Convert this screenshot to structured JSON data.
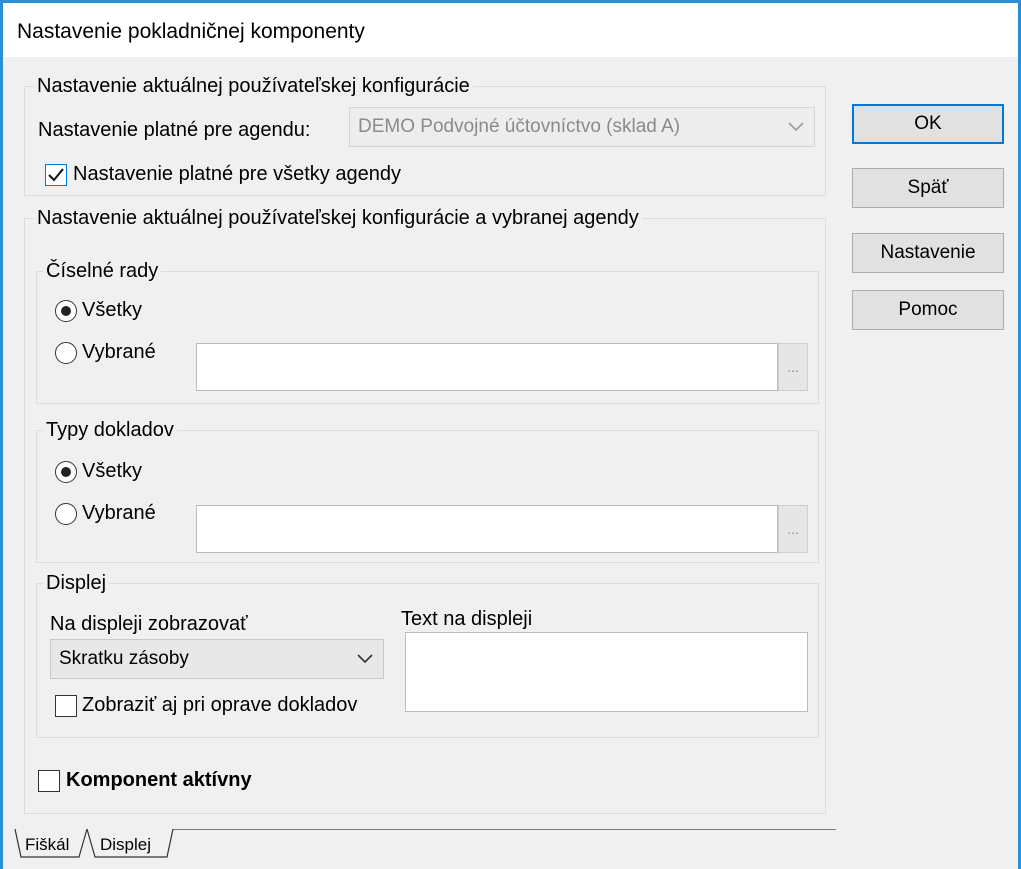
{
  "window": {
    "title": "Nastavenie pokladničnej komponenty"
  },
  "buttons": {
    "ok": "OK",
    "back": "Späť",
    "settings": "Nastavenie",
    "help": "Pomoc"
  },
  "user_config": {
    "legend": "Nastavenie aktuálnej používateľskej konfigurácie",
    "agenda_label": "Nastavenie platné pre agendu:",
    "agenda_value": "DEMO Podvojné účtovníctvo (sklad A)",
    "all_agendas_label": "Nastavenie platné pre všetky agendy",
    "all_agendas_checked": true
  },
  "user_agenda_config": {
    "legend": "Nastavenie aktuálnej používateľskej konfigurácie a vybranej agendy",
    "number_series": {
      "legend": "Číselné rady",
      "all_label": "Všetky",
      "selected_label": "Vybrané",
      "ellipsis": "..."
    },
    "document_types": {
      "legend": "Typy dokladov",
      "all_label": "Všetky",
      "selected_label": "Vybrané",
      "ellipsis": "..."
    },
    "display": {
      "legend": "Displej",
      "show_label": "Na displeji zobrazovať",
      "show_value": "Skratku zásoby",
      "text_label": "Text na displeji",
      "text_value": "",
      "show_on_edit_label": "Zobraziť aj pri oprave dokladov",
      "show_on_edit_checked": false
    }
  },
  "component_active": {
    "label": "Komponent aktívny",
    "checked": false
  },
  "tabs": [
    {
      "label": "Fiškál"
    },
    {
      "label": "Displej"
    }
  ],
  "icons": {
    "checkmark": "checkmark-icon",
    "dropdown": "chevron-down-icon"
  },
  "colors": {
    "accent": "#0078d7",
    "window_border": "#2b8fd6"
  }
}
